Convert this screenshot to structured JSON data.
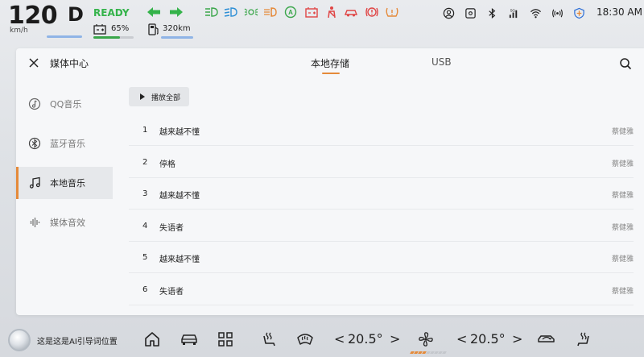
{
  "status": {
    "speed": "120",
    "speed_unit": "km/h",
    "gear": "D",
    "ready": "READY",
    "battery": "65%",
    "battery_level": 0.65,
    "range": "320km",
    "time": "18:30 AM",
    "telltales": [
      "headlight-icon",
      "low-beam-icon",
      "parking-light-icon",
      "fog-light-icon",
      "auto-hold-icon",
      "battery-warning-icon",
      "seatbelt-icon",
      "car-warning-icon",
      "brake-warning-icon",
      "tire-pressure-icon"
    ],
    "system_icons": [
      "user-icon",
      "settings-icon",
      "bluetooth-icon",
      "signal-icon",
      "wifi-icon",
      "hotspot-icon",
      "shield-icon"
    ],
    "colors": {
      "ready": "#34b34a",
      "turn_signal": "#34b34a",
      "telltale_green": "#3aa64a",
      "telltale_orange": "#e58a3a",
      "telltale_red": "#e04545"
    }
  },
  "panel": {
    "title": "媒体中心",
    "tabs": [
      {
        "label": "本地存储",
        "active": true
      },
      {
        "label": "USB",
        "active": false
      }
    ],
    "sidebar": [
      {
        "label": "QQ音乐",
        "icon": "qq-music-icon",
        "active": false
      },
      {
        "label": "蓝牙音乐",
        "icon": "bluetooth-icon",
        "active": false
      },
      {
        "label": "本地音乐",
        "icon": "music-note-icon",
        "active": true
      },
      {
        "label": "媒体音效",
        "icon": "sound-wave-icon",
        "active": false
      }
    ],
    "play_all_label": "播放全部",
    "songs": [
      {
        "num": "1",
        "title": "越来越不懂",
        "artist": "蔡健雅"
      },
      {
        "num": "2",
        "title": "停格",
        "artist": "蔡健雅"
      },
      {
        "num": "3",
        "title": "越来越不懂",
        "artist": "蔡健雅"
      },
      {
        "num": "4",
        "title": "失语者",
        "artist": "蔡健雅"
      },
      {
        "num": "5",
        "title": "越来越不懂",
        "artist": "蔡健雅"
      },
      {
        "num": "6",
        "title": "失语者",
        "artist": "蔡健雅"
      }
    ],
    "accent_color": "#e58a3a"
  },
  "dock": {
    "assistant_text": "这是这是AI引导词位置",
    "left_temp": "20.5°",
    "right_temp": "20.5°",
    "left_chevron": "<",
    "right_chevron": ">",
    "fan_level": 4,
    "fan_max": 9
  }
}
